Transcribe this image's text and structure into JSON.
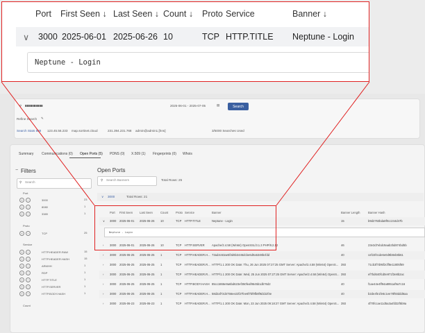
{
  "zoom": {
    "headers": [
      "Port",
      "First Seen",
      "Last Seen",
      "Count",
      "Proto",
      "Service",
      "Banner"
    ],
    "sort_icon": "↓",
    "expand_icon": "∨",
    "row": {
      "port": "3000",
      "first_seen": "2025-06-01",
      "last_seen": "2025-06-26",
      "count": "10",
      "proto": "TCP",
      "service": "HTTP.TITLE",
      "banner": "Neptune - Login"
    },
    "detail": "Neptune - Login"
  },
  "app": {
    "search_value": "8888888888",
    "date_range": "2025-06-01 - 2025-07-05",
    "search_button": "Search",
    "refine_label": "Refine Search",
    "stats": [
      "Search Stats 888",
      "123.45.56.233",
      "map.sortinet.cloud",
      "231.394.231.768",
      "admin@admin1.[hns]"
    ],
    "searches_used": "3/5000 Searches Used",
    "tabs": [
      "Summary",
      "Communications (0)",
      "Open Ports (5)",
      "PDNS (0)",
      "X.509 (1)",
      "Fingerprints (0)",
      "Whois"
    ],
    "filters_title": "Filters",
    "filter_search": "Search",
    "filter_groups": [
      {
        "name": "Port",
        "items": [
          {
            "label": "3000",
            "count": "23"
          },
          {
            "label": "8080",
            "count": "1"
          },
          {
            "label": "3389",
            "count": "1"
          }
        ]
      },
      {
        "name": "Proto",
        "items": [
          {
            "label": "TCP",
            "count": "25"
          }
        ]
      },
      {
        "name": "Service",
        "items": [
          {
            "label": "HTTP.HEADER.RAW",
            "count": "15"
          },
          {
            "label": "HTTP.HEADER.HASH",
            "count": "15"
          },
          {
            "label": "ARMHH",
            "count": "1"
          },
          {
            "label": "RDP",
            "count": "1"
          },
          {
            "label": "HTTP.TITLE",
            "count": "1"
          },
          {
            "label": "HTTP.SERVER",
            "count": "1"
          },
          {
            "label": "HTTP.BODY.HASH",
            "count": "1"
          }
        ]
      },
      {
        "name": "Count",
        "items": []
      }
    ],
    "ports_title": "Open Ports",
    "ports_search": "Search Banners",
    "total_rows": "Total Rows: 25",
    "group_label": "3000",
    "group_sub": "Total Rows: 21",
    "table_headers": [
      "Port",
      "First Seen",
      "Last Seen",
      "Count",
      "Proto",
      "Service",
      "Banner",
      "Banner Length",
      "Banner Hash"
    ],
    "rows": [
      {
        "port": "3000",
        "first": "2025-06-01",
        "last": "2025-06-26",
        "count": "10",
        "proto": "TCP",
        "service": "HTTP.TITLE",
        "banner": "Neptune - Login",
        "len": "15",
        "hash": "b9d2763bda8f0cc244d47b"
      },
      {
        "port": "3000",
        "first": "2025-06-01",
        "last": "2025-06-26",
        "count": "10",
        "proto": "TCP",
        "service": "HTTP.SERVER",
        "banner": "Apache/2.4.58 (Win64) OpenSSL/3.1.3 PHP/8.2.12",
        "len": "46",
        "hash": "23e3d7ebdc9aab2bd874bd5b"
      },
      {
        "port": "3000",
        "first": "2025-06-25",
        "last": "2025-06-25",
        "count": "1",
        "proto": "TCP",
        "service": "HTTP.HEADER.H...",
        "banner": "73ad4c63ae5f3d6b3445dcbe6d0a5348bcfdd",
        "len": "40",
        "hash": "cef22f4cde6e0d9b8eb8b61"
      },
      {
        "port": "3000",
        "first": "2025-06-25",
        "last": "2025-06-25",
        "count": "1",
        "proto": "TCP",
        "service": "HTTP.HEADER.R...",
        "banner": "HTTP/1.1 200 OK Date: Thu, 26 Jun 2025 07:27:25 GMT Server: Apache/2.4.58 (Win64) OpenS...",
        "len": "393",
        "hash": "71cb3f7d95f2cff8e11805f69"
      },
      {
        "port": "3000",
        "first": "2025-06-25",
        "last": "2025-06-25",
        "count": "1",
        "proto": "TCP",
        "service": "HTTP.HEADER.R...",
        "banner": "HTTP/1.1 200 OK Date: Wed, 25 Jun 2025 07:27:25 GMT Server: Apache/2.4.58 (Win64) OpenS...",
        "len": "393",
        "hash": "ef7bd640fcd0e971f3e8b2ac"
      },
      {
        "port": "3000",
        "first": "2025-06-25",
        "last": "2025-06-25",
        "count": "1",
        "proto": "TCP",
        "service": "HTTP.BODY.HASH",
        "banner": "85cc1866e9a6bd623ef350feaf9545b1db76d2",
        "len": "40",
        "hash": "f1ae44e4ff94a8951af9a7c16"
      },
      {
        "port": "3000",
        "first": "2025-06-25",
        "last": "2025-06-25",
        "count": "1",
        "proto": "TCP",
        "service": "HTTP.HEADER.H...",
        "banner": "58d2af72d4756ee22f27fee6f7bf9fb8f9d1b2f4e",
        "len": "40",
        "hash": "b2de4fe1fe6c1ee78f93ddd6aa"
      },
      {
        "port": "3000",
        "first": "2025-06-23",
        "last": "2025-06-23",
        "count": "1",
        "proto": "TCP",
        "service": "HTTP.HEADER.R...",
        "banner": "HTTP/1.1 200 OK Date: Mon, 23 Jun 2025 09:18:27 GMT Server: Apache/2.4.58 (Win64) OpenS...",
        "len": "393",
        "hash": "4f70fccae11d5a3a4fd32f5b9a"
      }
    ]
  }
}
